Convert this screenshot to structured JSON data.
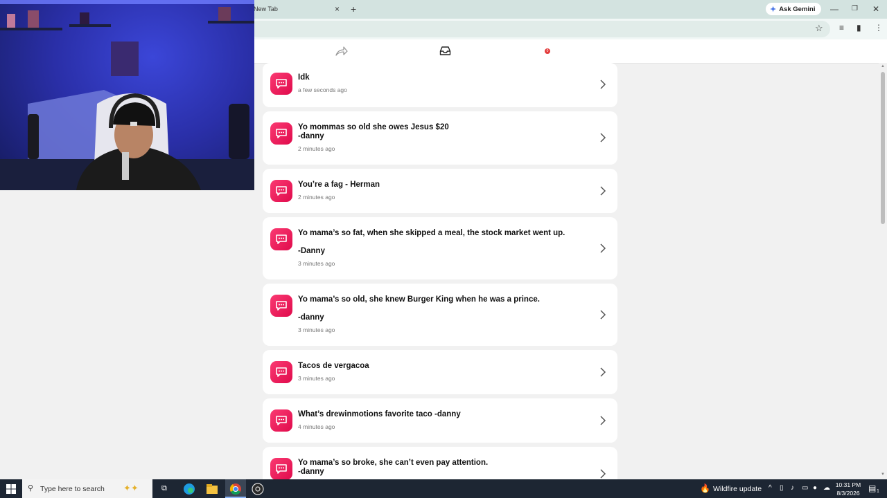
{
  "browser": {
    "tab_title": "New Tab",
    "tab_close": "×",
    "new_tab": "+",
    "gemini_label": "Ask Gemini",
    "window_controls": {
      "minimize": "—",
      "restore": "❐",
      "close": "✕"
    }
  },
  "app_header": {
    "notification_count": "0"
  },
  "messages": [
    {
      "text": "Idk",
      "time": "a few seconds ago"
    },
    {
      "text": "Yo mommas so old she owes Jesus $20\n-danny",
      "time": "2 minutes ago"
    },
    {
      "text": "You’re a fag - Herman",
      "time": "2 minutes ago"
    },
    {
      "text": "Yo mama’s so fat, when she skipped a meal, the stock market went up.\n\n-Danny",
      "time": "3 minutes ago"
    },
    {
      "text": "Yo mama’s so old, she knew Burger King when he was a prince.\n\n-danny",
      "time": "3 minutes ago"
    },
    {
      "text": "Tacos de vergacoa",
      "time": "3 minutes ago"
    },
    {
      "text": "What’s drewinmotions favorite taco -danny",
      "time": "4 minutes ago"
    },
    {
      "text": "Yo mama’s so broke, she can’t even pay attention.\n-danny",
      "time": ""
    }
  ],
  "taskbar": {
    "search_placeholder": "Type here to search",
    "weather_label": "Wildfire update",
    "time": "10:31 PM",
    "date": "8/3/2026",
    "notification_count": "1"
  },
  "colors": {
    "accent": "#f0195a",
    "tab_strip": "#d3e3e0",
    "taskbar": "#1d2633"
  }
}
